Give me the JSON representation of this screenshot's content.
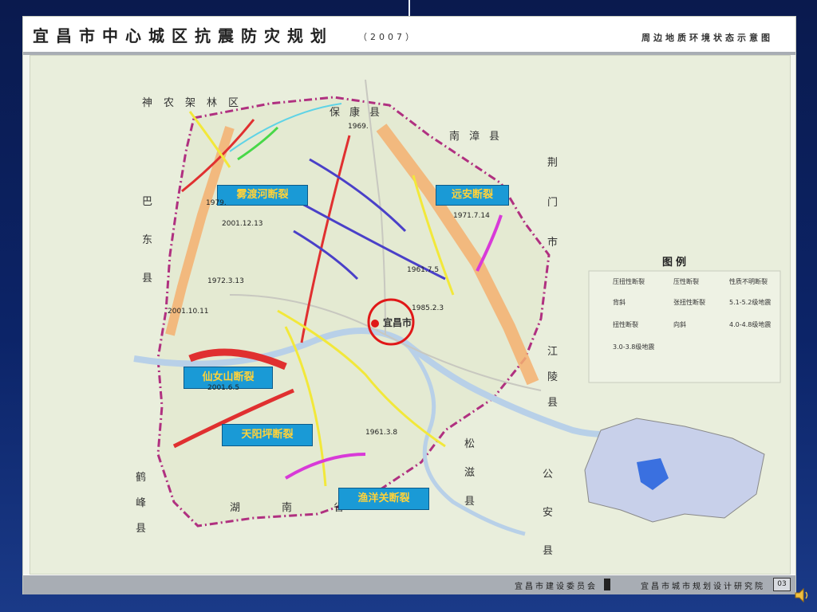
{
  "title": "宜昌市中心城区抗震防灾规划",
  "year": "（2007）",
  "subtitle": "周边地质环境状态示意图",
  "footer": {
    "left": "宜昌市建设委员会",
    "right": "宜昌市城市规划设计研究院",
    "page": "03"
  },
  "places": {
    "shennongjia": "神农架林区",
    "baokang": "保康县",
    "nanzhang": "南漳县",
    "jingmen": "荆门市",
    "badong": "巴东县",
    "jiangling": "江陵县",
    "songzi": "松滋县",
    "gongan": "公安县",
    "hefeng": "鹤峰县",
    "hunan": "湖南省",
    "city": "宜昌市"
  },
  "faults": {
    "wuduhe": "雾渡河断裂",
    "yuanan": "远安断裂",
    "xiannushan": "仙女山断裂",
    "tianyangping": "天阳坪断裂",
    "yuyangguan": "渔洋关断裂"
  },
  "earthquakes": [
    "1969.",
    "1971.7.14",
    "1979.",
    "2001.12.13",
    "1972.3.13",
    "1961.7.5",
    "1985.2.3",
    "2001.10.11",
    "2001.6.5",
    "1961.3.8"
  ],
  "legend": {
    "title": "图例",
    "items": [
      {
        "label": "压扭性断裂",
        "color": "#f2e83a",
        "kind": "line"
      },
      {
        "label": "压性断裂",
        "color": "#5fd3e6",
        "kind": "line"
      },
      {
        "label": "性质不明断裂",
        "color": "#d83ad8",
        "kind": "line"
      },
      {
        "label": "背斜",
        "color": "#e03030",
        "kind": "line"
      },
      {
        "label": "张扭性断裂",
        "color": "#f0a050",
        "kind": "line"
      },
      {
        "label": "5.1-5.2级地震",
        "color": "#d84040",
        "kind": "quake"
      },
      {
        "label": "扭性断裂",
        "color": "#4a40c8",
        "kind": "line"
      },
      {
        "label": "向斜",
        "color": "#48d848",
        "kind": "line"
      },
      {
        "label": "4.0-4.8级地震",
        "color": "#d84040",
        "kind": "quake"
      },
      {
        "label": "3.0-3.8级地震",
        "color": "#d84040",
        "kind": "quake"
      }
    ]
  }
}
